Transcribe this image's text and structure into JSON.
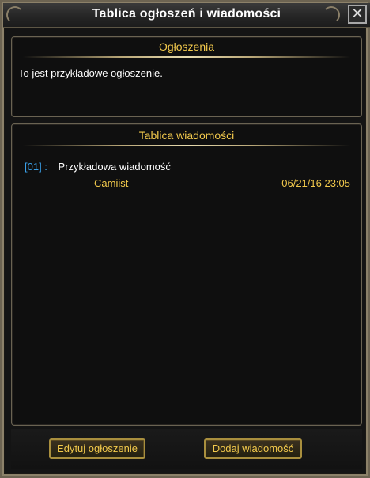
{
  "window": {
    "title": "Tablica ogłoszeń i wiadomości",
    "close_label": "✕"
  },
  "announcements": {
    "header": "Ogłoszenia",
    "text": "To jest przykładowe ogłoszenie."
  },
  "messages": {
    "header": "Tablica wiadomości",
    "items": [
      {
        "index": "[01] :",
        "text": "Przykładowa wiadomość",
        "author": "Camiist",
        "date": "06/21/16 23:05"
      }
    ]
  },
  "buttons": {
    "edit_label": "Edytuj ogłoszenie",
    "add_label": "Dodaj wiadomość"
  },
  "colors": {
    "accent_gold": "#f2c94c",
    "index_blue": "#3aa0e8",
    "text_white": "#ffffff",
    "frame": "#6d6452"
  },
  "icons": {
    "close": "close-icon",
    "corner": "corner-ornament-icon"
  }
}
